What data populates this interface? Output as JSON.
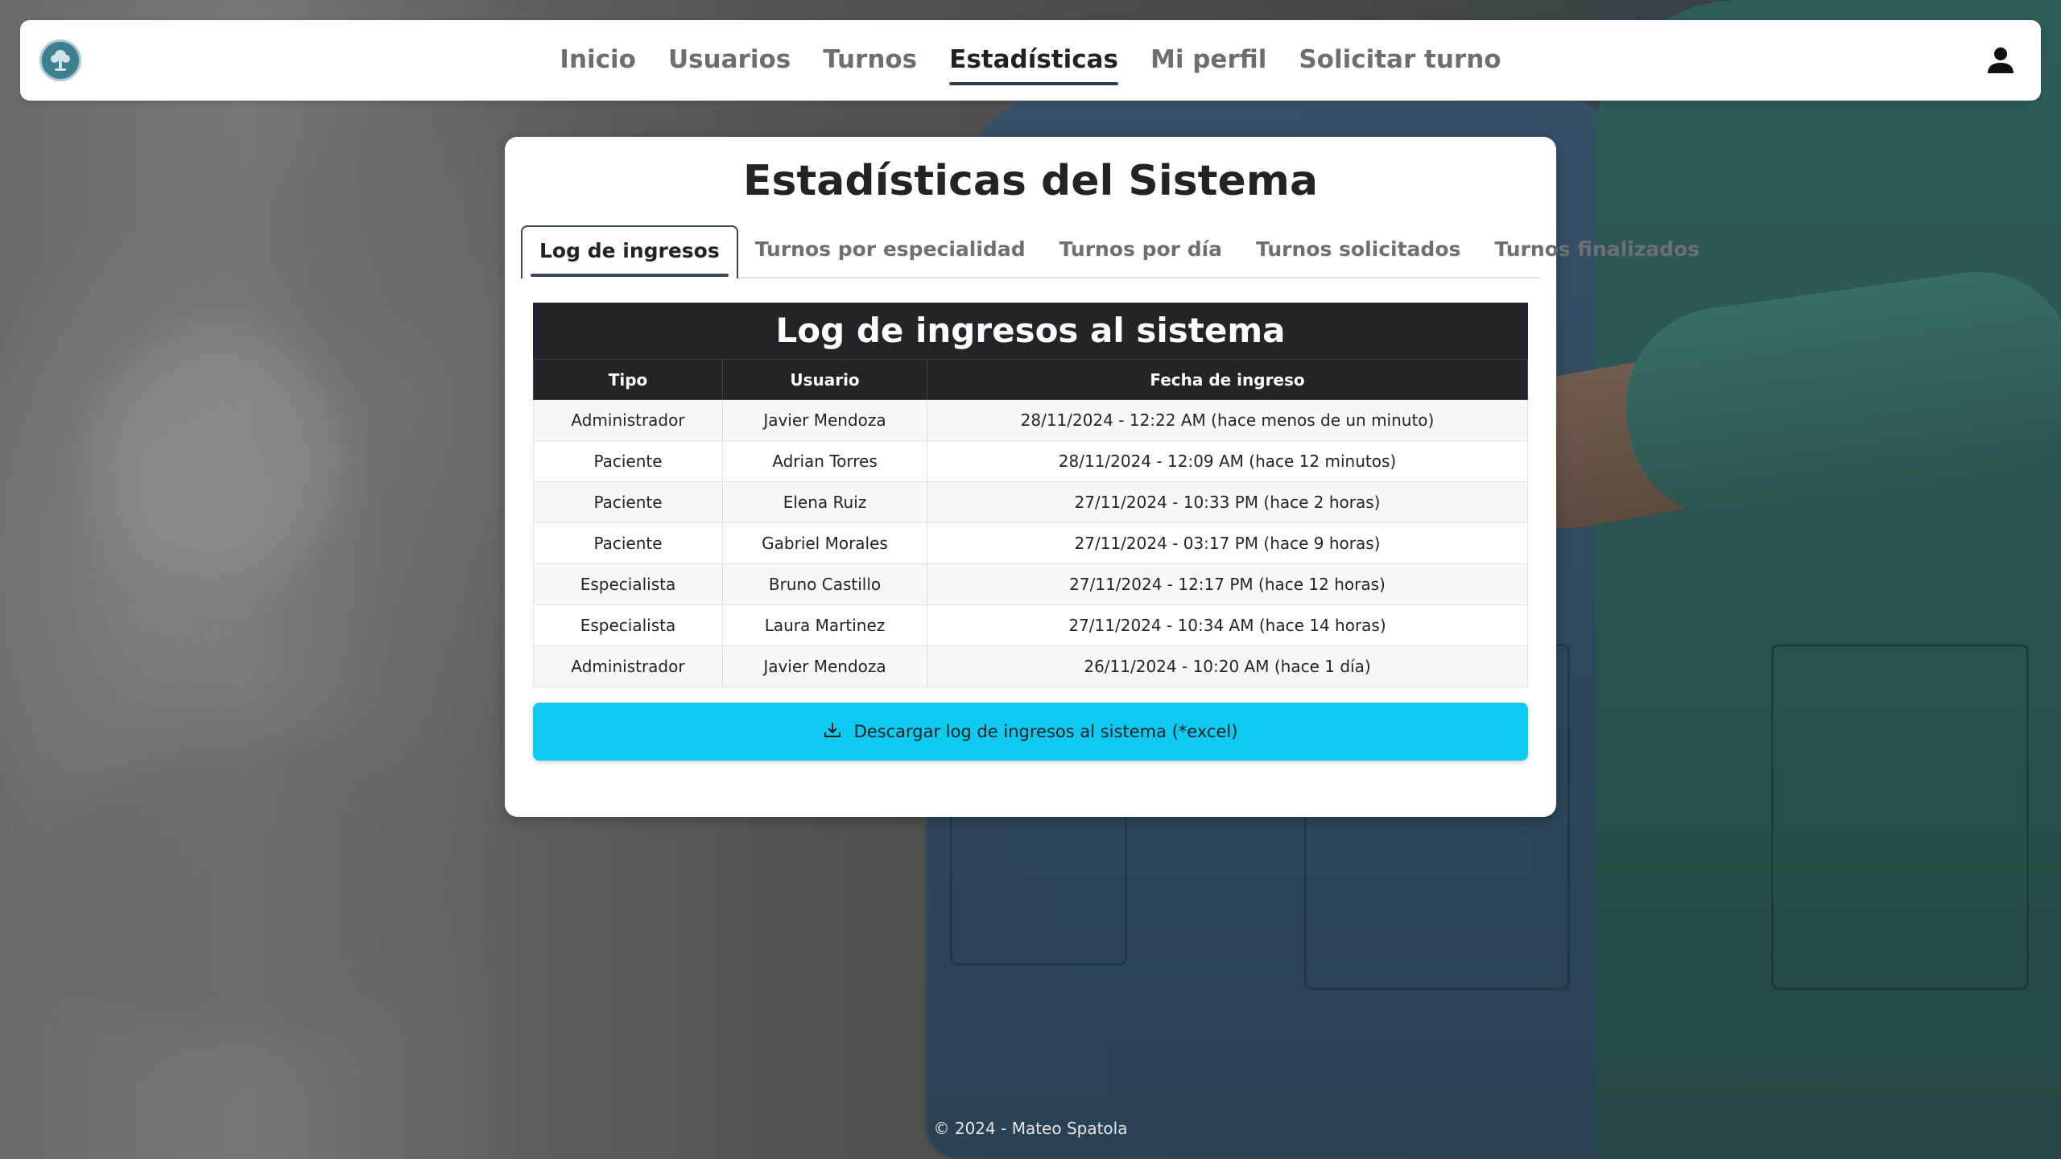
{
  "nav": {
    "items": [
      {
        "label": "Inicio",
        "active": false
      },
      {
        "label": "Usuarios",
        "active": false
      },
      {
        "label": "Turnos",
        "active": false
      },
      {
        "label": "Estadísticas",
        "active": true
      },
      {
        "label": "Mi perfil",
        "active": false
      },
      {
        "label": "Solicitar turno",
        "active": false
      }
    ],
    "logo_icon": "medical-tree-logo",
    "user_icon": "person-icon"
  },
  "page": {
    "title": "Estadísticas del Sistema"
  },
  "tabs": [
    {
      "label": "Log de ingresos",
      "active": true
    },
    {
      "label": "Turnos por especialidad",
      "active": false
    },
    {
      "label": "Turnos por día",
      "active": false
    },
    {
      "label": "Turnos solicitados",
      "active": false
    },
    {
      "label": "Turnos finalizados",
      "active": false
    }
  ],
  "log_table": {
    "caption": "Log de ingresos al sistema",
    "headers": [
      "Tipo",
      "Usuario",
      "Fecha de ingreso"
    ],
    "rows": [
      [
        "Administrador",
        "Javier Mendoza",
        "28/11/2024 - 12:22 AM (hace menos de un minuto)"
      ],
      [
        "Paciente",
        "Adrian Torres",
        "28/11/2024 - 12:09 AM (hace 12 minutos)"
      ],
      [
        "Paciente",
        "Elena Ruiz",
        "27/11/2024 - 10:33 PM (hace 2 horas)"
      ],
      [
        "Paciente",
        "Gabriel Morales",
        "27/11/2024 - 03:17 PM (hace 9 horas)"
      ],
      [
        "Especialista",
        "Bruno Castillo",
        "27/11/2024 - 12:17 PM (hace 12 horas)"
      ],
      [
        "Especialista",
        "Laura Martinez",
        "27/11/2024 - 10:34 AM (hace 14 horas)"
      ],
      [
        "Administrador",
        "Javier Mendoza",
        "26/11/2024 - 10:20 AM (hace 1 día)"
      ]
    ]
  },
  "download": {
    "label": "Descargar log de ingresos al sistema (*excel)",
    "icon": "download-icon",
    "color": "#0dcaf0"
  },
  "footer": {
    "text": "© 2024 - Mateo Spatola"
  },
  "colors": {
    "table_header": "#212529",
    "active_nav_underline": "#2b3f52"
  }
}
